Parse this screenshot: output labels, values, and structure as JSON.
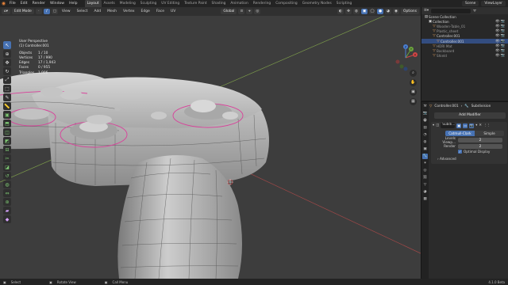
{
  "menu": [
    "File",
    "Edit",
    "Render",
    "Window",
    "Help"
  ],
  "workspaces": [
    "Layout",
    "Assets",
    "Modeling",
    "Sculpting",
    "UV Editing",
    "Texture Paint",
    "Shading",
    "Animation",
    "Rendering",
    "Compositing",
    "Geometry Nodes",
    "Scripting"
  ],
  "active_workspace": "Layout",
  "top_right": {
    "scene_label": "Scene",
    "viewlayer_label": "ViewLayer"
  },
  "viewport_header": {
    "mode": "Edit Mode",
    "menus": [
      "View",
      "Select",
      "Add",
      "Mesh",
      "Vertex",
      "Edge",
      "Face",
      "UV"
    ],
    "orientation": "Global",
    "options": "Options"
  },
  "overlay": {
    "view_name": "User Perspective",
    "object_name": "(1) Controller.001",
    "stats": [
      {
        "label": "Objects",
        "value": "1 / 10"
      },
      {
        "label": "Vertices",
        "value": "17 / 990"
      },
      {
        "label": "Edges",
        "value": "17 / 1,943"
      },
      {
        "label": "Faces",
        "value": "0 / 955"
      },
      {
        "label": "Triangles",
        "value": "1,906"
      }
    ]
  },
  "gizmo": {
    "x": "X",
    "y": "Y",
    "z": "Z"
  },
  "outliner": {
    "title": "Scene Collection",
    "rows": [
      {
        "label": "Collection",
        "indent": 1,
        "icon": "▣",
        "selected": false,
        "dim": false
      },
      {
        "label": "Wooden-Table_01",
        "indent": 2,
        "icon": "▽",
        "selected": false,
        "dim": true
      },
      {
        "label": "Plastic_sheet",
        "indent": 2,
        "icon": "▽",
        "selected": false,
        "dim": true
      },
      {
        "label": "Controller.001",
        "indent": 2,
        "icon": "▽",
        "selected": false,
        "dim": false
      },
      {
        "label": "Controller.001",
        "indent": 3,
        "icon": "▽",
        "selected": true,
        "dim": false
      },
      {
        "label": "HDRI Mat",
        "indent": 2,
        "icon": "▽",
        "selected": false,
        "dim": true
      },
      {
        "label": "Backboard",
        "indent": 2,
        "icon": "▽",
        "selected": false,
        "dim": true
      },
      {
        "label": "Shield",
        "indent": 2,
        "icon": "▽",
        "selected": false,
        "dim": true
      }
    ]
  },
  "properties": {
    "breadcrumb_object": "Controller.001",
    "breadcrumb_modifier": "Subdivision",
    "add_modifier": "Add Modifier",
    "modifier_name": "Subdi...",
    "methods": [
      "Catmull-Clark",
      "Simple"
    ],
    "levels_viewport_label": "Levels Viewp...",
    "levels_viewport_value": "2",
    "render_label": "Render",
    "render_value": "2",
    "optimal_display": "Optimal Display",
    "advanced": "Advanced"
  },
  "status": {
    "select": "Select",
    "rotate": "Rotate View",
    "menu": "Call Menu",
    "version": "4.1.0 Beta"
  },
  "colors": {
    "accent": "#4772b3",
    "viewport_bg": "#3d3d3d",
    "mesh": "#b5b5b5",
    "seam": "#d9409a"
  }
}
